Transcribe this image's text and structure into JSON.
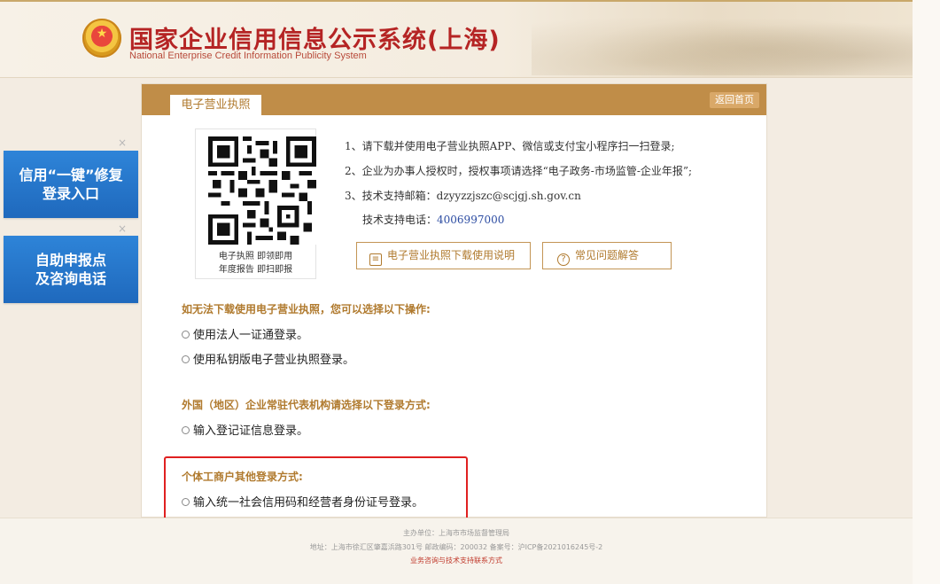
{
  "header": {
    "title": "国家企业信用信息公示系统(上海)",
    "subtitle": "National Enterprise Credit Information Publicity System"
  },
  "side": {
    "close_symbol": "×",
    "card1": [
      "信用“一键”修复",
      "登录入口"
    ],
    "card2": [
      "自助申报点",
      "及咨询电话"
    ]
  },
  "panel": {
    "tab_label": "电子营业执照",
    "home_label": "返回首页",
    "qr_caption": [
      "电子执照 即领即用",
      "年度报告 即扫即报"
    ],
    "instructions": [
      "1、请下载并使用电子营业执照APP、微信或支付宝小程序扫一扫登录;",
      "2、企业为办事人授权时，授权事项请选择“电子政务-市场监管-企业年报”;",
      "3、技术支持邮箱：dzyyzzjszc@scjgj.sh.gov.cn"
    ],
    "phone_label": "技术支持电话：",
    "phone_number": "4006997000",
    "btn_download": "电子营业执照下载使用说明",
    "btn_faq": "常见问题解答"
  },
  "sections": [
    {
      "title": "如无法下载使用电子营业执照，您可以选择以下操作:",
      "options": [
        "使用法人一证通登录。",
        "使用私钥版电子营业执照登录。"
      ]
    },
    {
      "title": "外国（地区）企业常驻代表机构请选择以下登录方式:",
      "options": [
        "输入登记证信息登录。"
      ]
    },
    {
      "title": "个体工商户其他登录方式:",
      "options": [
        "输入统一社会信用码和经营者身份证号登录。"
      ]
    }
  ],
  "footer": {
    "line1": "主办单位：上海市市场监督管理局",
    "line2": "地址：上海市徐汇区肇嘉浜路301号 邮政编码：200032 备案号：沪ICP备2021016245号-2",
    "line3": "业务咨询与技术支持联系方式"
  },
  "colors": {
    "accent": "#c08d48",
    "title_red": "#b52424",
    "side_blue": "#2677cc",
    "highlight": "#e02020"
  }
}
